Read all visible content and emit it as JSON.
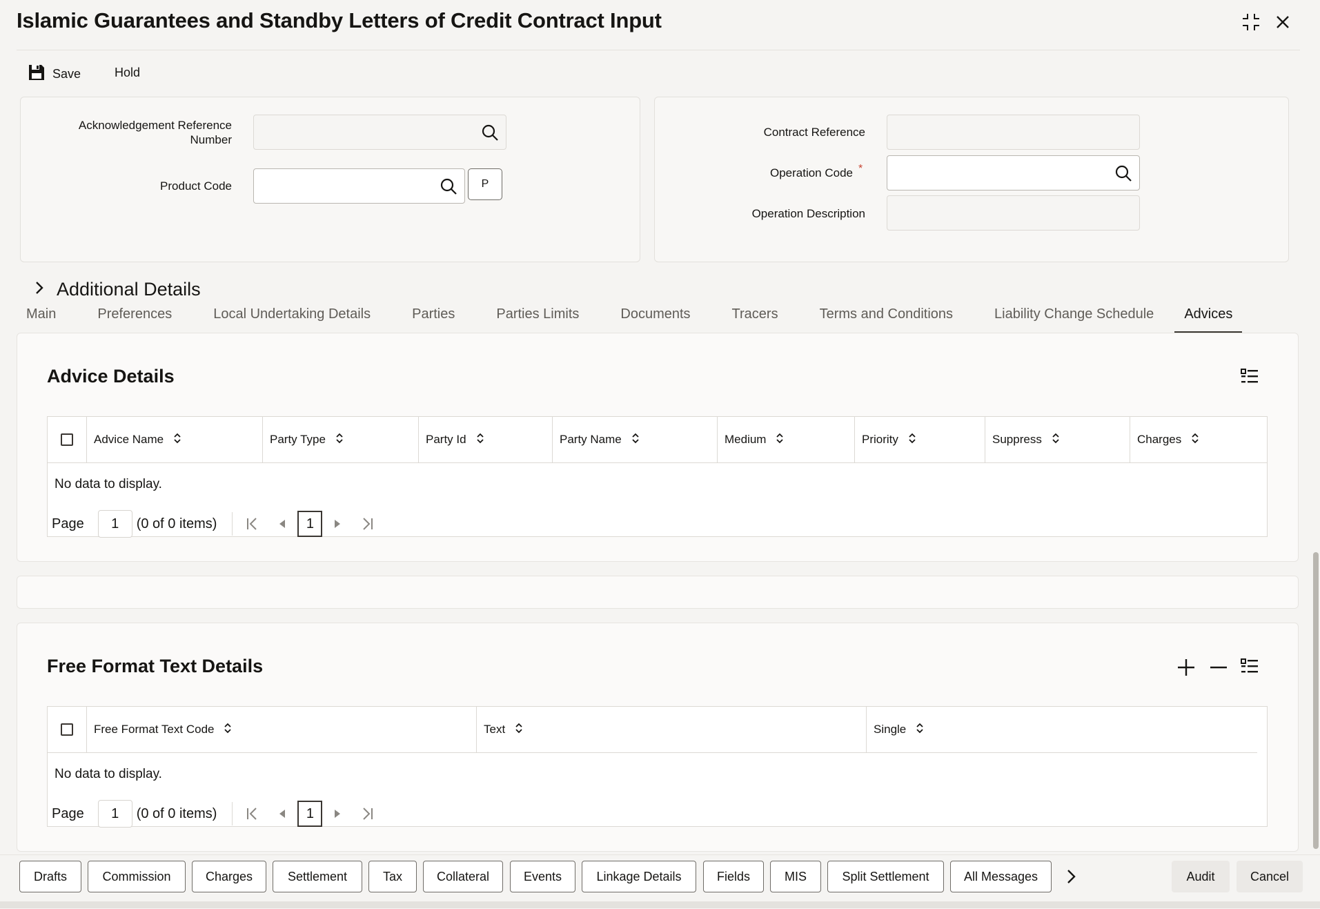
{
  "window": {
    "title": "Islamic Guarantees and Standby Letters of Credit Contract Input"
  },
  "toolbar": {
    "save_label": "Save",
    "hold_label": "Hold"
  },
  "header_form": {
    "ack_ref_label": "Acknowledgement Reference Number",
    "ack_ref_value": "",
    "product_code_label": "Product Code",
    "product_code_value": "",
    "p_button": "P",
    "contract_ref_label": "Contract Reference",
    "contract_ref_value": "",
    "operation_code_label": "Operation Code",
    "operation_code_required": "*",
    "operation_code_value": "",
    "operation_desc_label": "Operation Description",
    "operation_desc_value": ""
  },
  "additional_details": {
    "label": "Additional Details"
  },
  "tabs": [
    {
      "label": "Main"
    },
    {
      "label": "Preferences"
    },
    {
      "label": "Local Undertaking Details"
    },
    {
      "label": "Parties"
    },
    {
      "label": "Parties Limits"
    },
    {
      "label": "Documents"
    },
    {
      "label": "Tracers"
    },
    {
      "label": "Terms and Conditions"
    },
    {
      "label": "Liability Change Schedule"
    },
    {
      "label": "Advices"
    }
  ],
  "active_tab": "Advices",
  "advice_details": {
    "title": "Advice Details",
    "columns": [
      "Advice Name",
      "Party Type",
      "Party Id",
      "Party Name",
      "Medium",
      "Priority",
      "Suppress",
      "Charges"
    ],
    "empty_text": "No data to display.",
    "pager": {
      "page_label": "Page",
      "page_value": "1",
      "items_text": "(0 of 0 items)",
      "current_page": "1"
    }
  },
  "free_format": {
    "title": "Free Format Text Details",
    "columns": [
      "Free Format Text Code",
      "Text",
      "Single"
    ],
    "empty_text": "No data to display.",
    "pager": {
      "page_label": "Page",
      "page_value": "1",
      "items_text": "(0 of 0 items)",
      "current_page": "1"
    }
  },
  "bottom_buttons": {
    "drafts": "Drafts",
    "commission": "Commission",
    "charges": "Charges",
    "settlement": "Settlement",
    "tax": "Tax",
    "collateral": "Collateral",
    "events": "Events",
    "linkage": "Linkage Details",
    "fields": "Fields",
    "mis": "MIS",
    "split": "Split Settlement",
    "all_messages": "All Messages",
    "audit": "Audit",
    "cancel": "Cancel"
  }
}
